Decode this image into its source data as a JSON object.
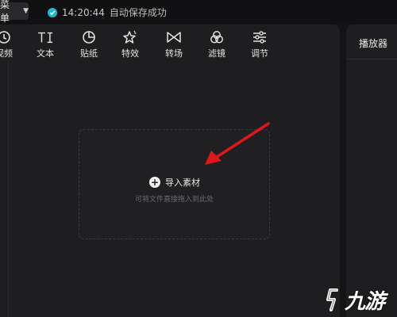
{
  "topbar": {
    "menu_label": "菜单",
    "time": "14:20:44",
    "status": "自动保存成功"
  },
  "toolbar": {
    "items": [
      {
        "label": "视频",
        "icon": "video-icon"
      },
      {
        "label": "文本",
        "icon": "text-icon"
      },
      {
        "label": "贴纸",
        "icon": "sticker-icon"
      },
      {
        "label": "特效",
        "icon": "effects-icon"
      },
      {
        "label": "转场",
        "icon": "transition-icon"
      },
      {
        "label": "滤镜",
        "icon": "filter-icon"
      },
      {
        "label": "调节",
        "icon": "adjust-icon"
      }
    ]
  },
  "dropzone": {
    "import_label": "导入素材",
    "hint": "可将文件直接拖入到此处"
  },
  "player": {
    "tab_label": "播放器"
  },
  "watermark": {
    "text": "九游"
  },
  "colors": {
    "accent": "#22b8cf",
    "arrow": "#e0161b",
    "panel": "#1e1e20",
    "background": "#131315"
  }
}
